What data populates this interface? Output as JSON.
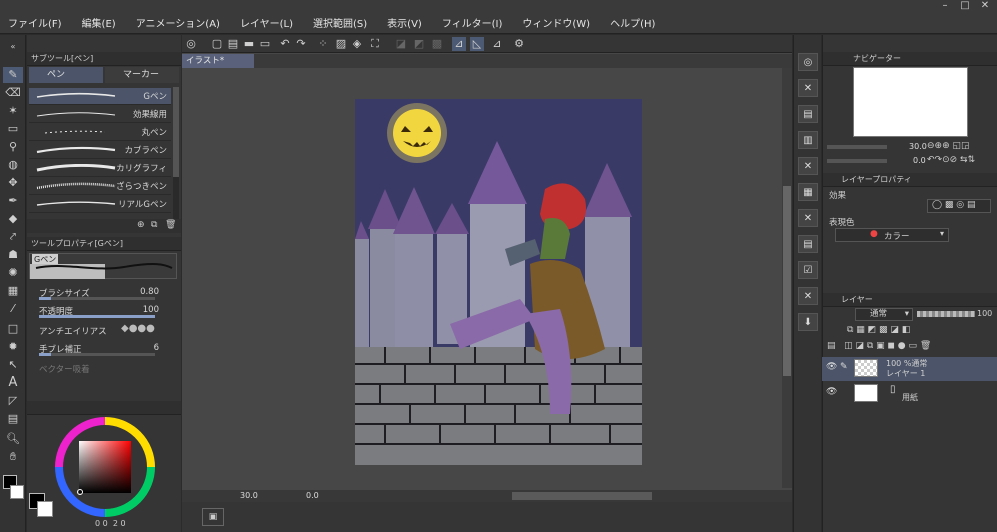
{
  "menu": [
    "ファイル(F)",
    "編集(E)",
    "アニメーション(A)",
    "レイヤー(L)",
    "選択範囲(S)",
    "表示(V)",
    "フィルター(I)",
    "ウィンドウ(W)",
    "ヘルプ(H)"
  ],
  "window_controls": {
    "minimize": "–",
    "maximize": "□",
    "close": "✕"
  },
  "subtool": {
    "panel_title": "サブツール[ペン]",
    "tabs": [
      "ペン",
      "マーカー"
    ],
    "brushes": [
      "Gペン",
      "効果線用",
      "丸ペン",
      "カブラペン",
      "カリグラフィ",
      "ざらつきペン",
      "リアルGペン"
    ],
    "selected_index": 0
  },
  "toolprop": {
    "panel_title": "ツールプロパティ[Gペン]",
    "preview_label": "Gペン",
    "brush_size_label": "ブラシサイズ",
    "brush_size_value": "0.80",
    "brush_size_fraction": 0.1,
    "opacity_label": "不透明度",
    "opacity_value": "100",
    "opacity_fraction": 1.0,
    "antialias_label": "アンチエイリアス",
    "stabilization_label": "手ブレ補正",
    "stabilization_value": "6",
    "stabilization_fraction": 0.1,
    "vector_label": "ベクター吸着"
  },
  "color": {
    "main_color": "#000000",
    "sub_color": "#ffffff",
    "hue_color": "#ff0000",
    "readout": [
      "0",
      "0",
      "2",
      "0"
    ]
  },
  "document": {
    "tab_title": "イラスト*"
  },
  "status": {
    "zoom": "30.0",
    "angle": "0.0"
  },
  "navigator": {
    "title": "ナビゲーター",
    "zoom": "30.0",
    "angle": "0.0"
  },
  "layer_property": {
    "title": "レイヤープロパティ",
    "effect_label": "効果",
    "expression_label": "表現色",
    "expression_value": "カラー"
  },
  "layers": {
    "title": "レイヤー",
    "blend_mode": "通常",
    "opacity": "100",
    "items": [
      {
        "mode": "100 %通常",
        "name": "レイヤー 1"
      },
      {
        "mode": "",
        "name": "用紙"
      }
    ]
  }
}
